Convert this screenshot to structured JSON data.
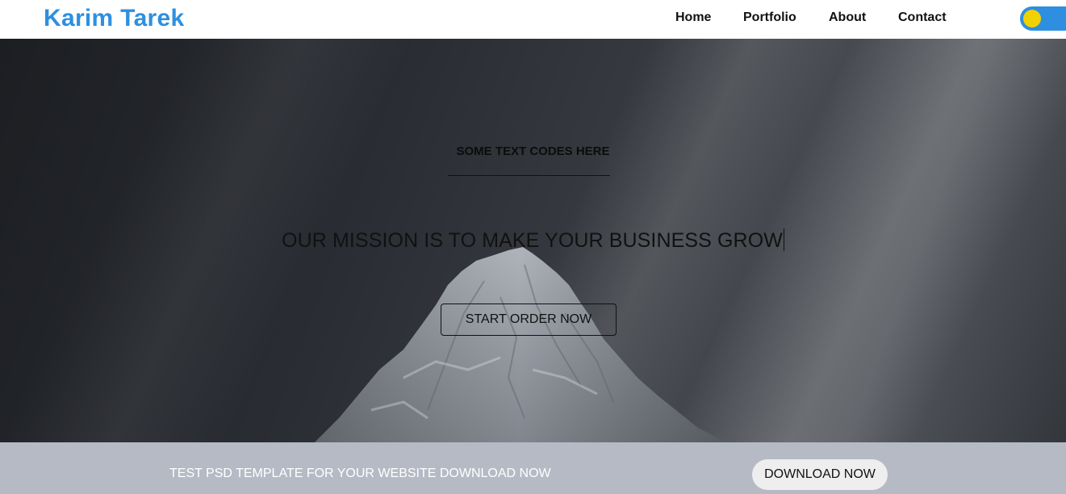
{
  "header": {
    "brand": "Karim Tarek",
    "nav": [
      "Home",
      "Portfolio",
      "About",
      "Contact"
    ],
    "theme_toggle": {
      "state": "on",
      "track_color": "#2e8fe0",
      "knob_color": "#f2d100"
    }
  },
  "hero": {
    "subtitle": "SOME TEXT CODES HERE",
    "title": "OUR MISSION IS TO MAKE YOUR BUSINESS GROW",
    "button_label": "START ORDER NOW"
  },
  "footer": {
    "text": "TEST PSD TEMPLATE FOR YOUR WEBSITE DOWNLOAD NOW",
    "button_label": "DOWNLOAD NOW"
  },
  "colors": {
    "brand": "#2e8fe0",
    "footer_bg": "#b6bac5"
  }
}
